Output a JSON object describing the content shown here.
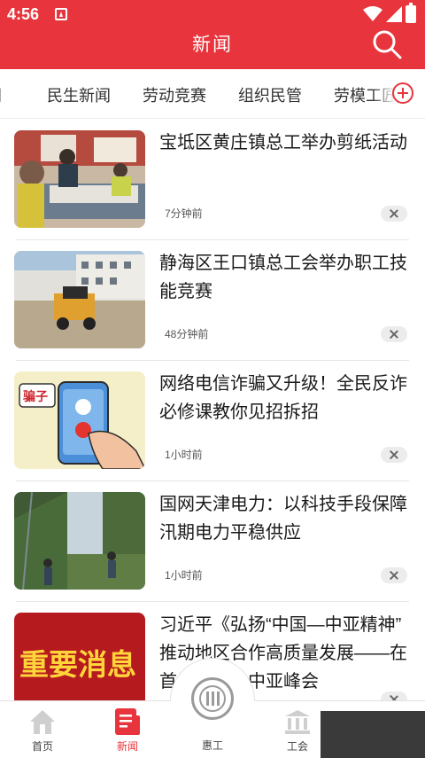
{
  "status_bar": {
    "time": "4:56"
  },
  "header": {
    "title": "新闻"
  },
  "tabs": [
    "新闻",
    "民生新闻",
    "劳动竞赛",
    "组织民管",
    "劳模工匠"
  ],
  "news": [
    {
      "headline": "宝坻区黄庄镇总工举办剪纸活动",
      "time_ago": "7分钟前"
    },
    {
      "headline": "静海区王口镇总工会举办职工技能竞赛",
      "time_ago": "48分钟前"
    },
    {
      "headline": "网络电信诈骗又升级！全民反诈必修课教你见招拆招",
      "time_ago": "1小时前",
      "image_text": "骗子"
    },
    {
      "headline": "国网天津电力：以科技手段保障汛期电力平稳供应",
      "time_ago": "1小时前"
    },
    {
      "headline": "习近平《弘扬“中国—中亚精神” 推动地区合作高质量发展——在首届中国—中亚峰会",
      "time_ago": "",
      "image_text": "重要消息"
    }
  ],
  "bottom_nav": {
    "home": "首页",
    "news": "新闻",
    "benefits": "惠工",
    "union": "工会"
  },
  "colors": {
    "brand": "#e8343c",
    "text": "#1a1a1a",
    "muted": "#555555"
  }
}
